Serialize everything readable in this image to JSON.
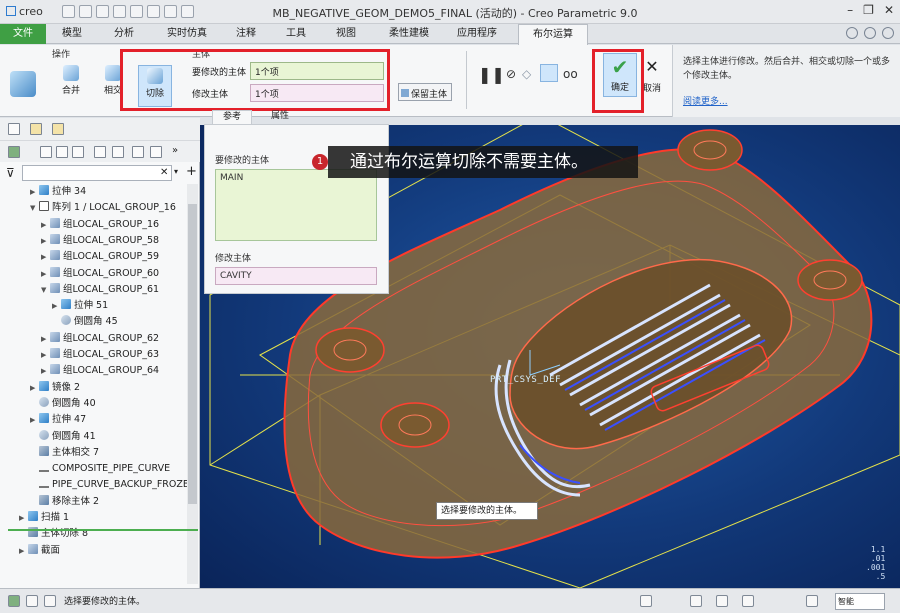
{
  "app": {
    "logo": "creo",
    "title": "MB_NEGATIVE_GEOM_DEMO5_FINAL (活动的) - Creo Parametric 9.0"
  },
  "tabs": [
    "文件",
    "模型",
    "分析",
    "实时仿真",
    "注释",
    "工具",
    "视图",
    "柔性建模",
    "应用程序",
    "布尔运算"
  ],
  "ribbon": {
    "group_label": "操作",
    "op_group_label": "主体",
    "merge": "合并",
    "intersect": "相交",
    "cut": "切除",
    "body_to_modify_label": "要修改的主体",
    "body_to_modify_value": "1个项",
    "modifying_body_label": "修改主体",
    "modifying_body_value": "1个项",
    "keep_body": "保留主体",
    "confirm": "确定",
    "cancel": "取消",
    "help_text": "选择主体进行修改。然后合并、相交或切除一个或多个修改主体。",
    "help_link": "阅读更多..."
  },
  "dashboard": {
    "tabs": [
      "参考",
      "属性"
    ],
    "body_to_modify_label": "要修改的主体",
    "body_to_modify_item": "MAIN",
    "modifying_body_label": "修改主体",
    "modifying_body_item": "CAVITY"
  },
  "tree": [
    {
      "label": "拉伸 34",
      "icon": "extrude-icon",
      "indent": 2,
      "exp": "▶"
    },
    {
      "label": "阵列 1 / LOCAL_GROUP_16",
      "icon": "pattern-icon",
      "indent": 2,
      "exp": "▼"
    },
    {
      "label": "组LOCAL_GROUP_16",
      "icon": "group-icon",
      "indent": 3,
      "exp": "▶"
    },
    {
      "label": "组LOCAL_GROUP_58",
      "icon": "group-icon",
      "indent": 3,
      "exp": "▶"
    },
    {
      "label": "组LOCAL_GROUP_59",
      "icon": "group-icon",
      "indent": 3,
      "exp": "▶"
    },
    {
      "label": "组LOCAL_GROUP_60",
      "icon": "group-icon",
      "indent": 3,
      "exp": "▶"
    },
    {
      "label": "组LOCAL_GROUP_61",
      "icon": "group-icon",
      "indent": 3,
      "exp": "▼"
    },
    {
      "label": "拉伸 51",
      "icon": "extrude-icon",
      "indent": 4,
      "exp": "▶"
    },
    {
      "label": "倒圆角 45",
      "icon": "round-icon",
      "indent": 4,
      "exp": ""
    },
    {
      "label": "组LOCAL_GROUP_62",
      "icon": "group-icon",
      "indent": 3,
      "exp": "▶"
    },
    {
      "label": "组LOCAL_GROUP_63",
      "icon": "group-icon",
      "indent": 3,
      "exp": "▶"
    },
    {
      "label": "组LOCAL_GROUP_64",
      "icon": "group-icon",
      "indent": 3,
      "exp": "▶"
    },
    {
      "label": "镜像 2",
      "icon": "mirror-icon",
      "indent": 2,
      "exp": "▶"
    },
    {
      "label": "倒圆角 40",
      "icon": "round-icon",
      "indent": 2,
      "exp": ""
    },
    {
      "label": "拉伸 47",
      "icon": "extrude-icon",
      "indent": 2,
      "exp": "▶"
    },
    {
      "label": "倒圆角 41",
      "icon": "round-icon",
      "indent": 2,
      "exp": ""
    },
    {
      "label": "主体相交 7",
      "icon": "boolean-icon",
      "indent": 2,
      "exp": ""
    },
    {
      "label": "COMPOSITE_PIPE_CURVE",
      "icon": "curve-icon",
      "indent": 2,
      "exp": ""
    },
    {
      "label": "PIPE_CURVE_BACKUP_FROZEN",
      "icon": "curve-icon",
      "indent": 2,
      "exp": ""
    },
    {
      "label": "移除主体 2",
      "icon": "boolean-icon",
      "indent": 2,
      "exp": ""
    },
    {
      "label": "扫描 1",
      "icon": "sweep-icon",
      "indent": 1,
      "exp": "▶"
    },
    {
      "label": "主体切除 8",
      "icon": "boolean-icon",
      "indent": 1,
      "exp": ""
    },
    {
      "label": "截面",
      "icon": "section-icon",
      "indent": 1,
      "exp": "▶"
    }
  ],
  "graphics": {
    "callout": "通过布尔运算切除不需要主体。",
    "callout_bullet": "1",
    "tooltip": "选择要修改的主体。",
    "csys_label": "PRT_CSYS_DEF",
    "scale_text": [
      "1.1",
      ".01",
      ".001",
      ".5"
    ]
  },
  "status": {
    "message": "选择要修改的主体。",
    "filter": "智能"
  },
  "colors": {
    "file_tab": "#3f9f44",
    "highlight_red": "#e3202a",
    "confirm_green": "#3aa14a",
    "body_field_green": "#e9f5d5",
    "body_field_pink": "#f7e9f4"
  }
}
